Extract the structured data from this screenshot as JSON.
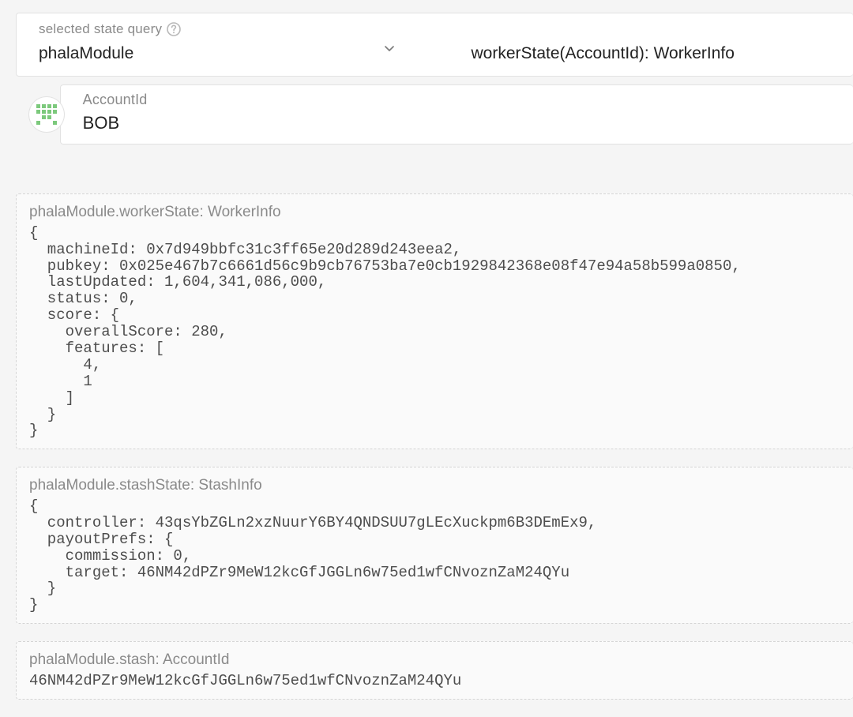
{
  "query": {
    "label": "selected state query",
    "module": "phalaModule",
    "method": "workerState(AccountId): WorkerInfo"
  },
  "account": {
    "label": "AccountId",
    "value": "BOB"
  },
  "results": {
    "workerState": {
      "title": "phalaModule.workerState: WorkerInfo",
      "body": "{\n  machineId: 0x7d949bbfc31c3ff65e20d289d243eea2,\n  pubkey: 0x025e467b7c6661d56c9b9cb76753ba7e0cb1929842368e08f47e94a58b599a0850,\n  lastUpdated: 1,604,341,086,000,\n  status: 0,\n  score: {\n    overallScore: 280,\n    features: [\n      4,\n      1\n    ]\n  }\n}"
    },
    "stashState": {
      "title": "phalaModule.stashState: StashInfo",
      "body": "{\n  controller: 43qsYbZGLn2xzNuurY6BY4QNDSUU7gLEcXuckpm6B3DEmEx9,\n  payoutPrefs: {\n    commission: 0,\n    target: 46NM42dPZr9MeW12kcGfJGGLn6w75ed1wfCNvoznZaM24QYu\n  }\n}"
    },
    "stash": {
      "title": "phalaModule.stash: AccountId",
      "body": "46NM42dPZr9MeW12kcGfJGGLn6w75ed1wfCNvoznZaM24QYu"
    }
  }
}
